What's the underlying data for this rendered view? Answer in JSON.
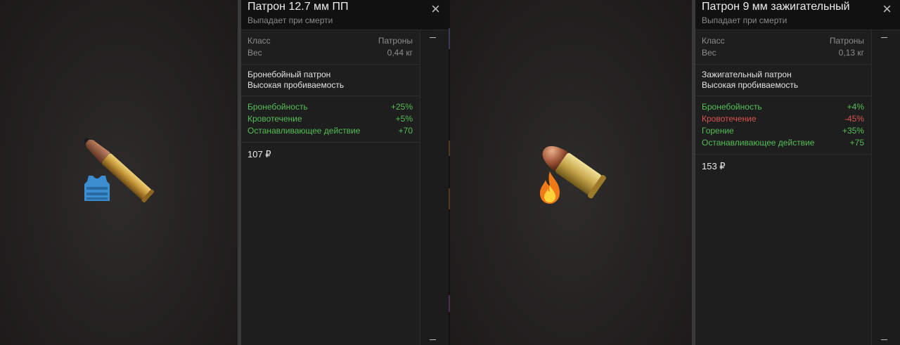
{
  "left_panel": {
    "title": "Патрон 12.7 мм ПП",
    "subtitle": "Выпадает при смерти",
    "close_label": "×",
    "class_label": "Класс",
    "class_value": "Патроны",
    "weight_label": "Вес",
    "weight_value": "0,44 кг",
    "description": [
      "Бронебойный патрон",
      "Высокая пробиваемость"
    ],
    "stats": [
      {
        "name": "Бронебойность",
        "value": "+25%",
        "color": "#55bf55"
      },
      {
        "name": "Кровотечение",
        "value": "+5%",
        "color": "#55bf55"
      },
      {
        "name": "Останавливающее действие",
        "value": "+70",
        "color": "#55bf55"
      }
    ],
    "price": "107 ₽",
    "badge_icon": "armor-vest-icon"
  },
  "right_panel": {
    "title": "Патрон 9 мм зажигательный",
    "subtitle": "Выпадает при смерти",
    "close_label": "×",
    "class_label": "Класс",
    "class_value": "Патроны",
    "weight_label": "Вес",
    "weight_value": "0,13 кг",
    "description": [
      "Зажигательный патрон",
      "Высокая пробиваемость"
    ],
    "stats": [
      {
        "name": "Бронебойность",
        "value": "+4%",
        "color": "#55bf55"
      },
      {
        "name": "Кровотечение",
        "value": "-45%",
        "color": "#d9534f"
      },
      {
        "name": "Горение",
        "value": "+35%",
        "color": "#55bf55"
      },
      {
        "name": "Останавливающее действие",
        "value": "+75",
        "color": "#55bf55"
      }
    ],
    "price": "153 ₽",
    "badge_icon": "fire-icon"
  },
  "colors": {
    "positive": "#55bf55",
    "negative": "#d9534f"
  }
}
